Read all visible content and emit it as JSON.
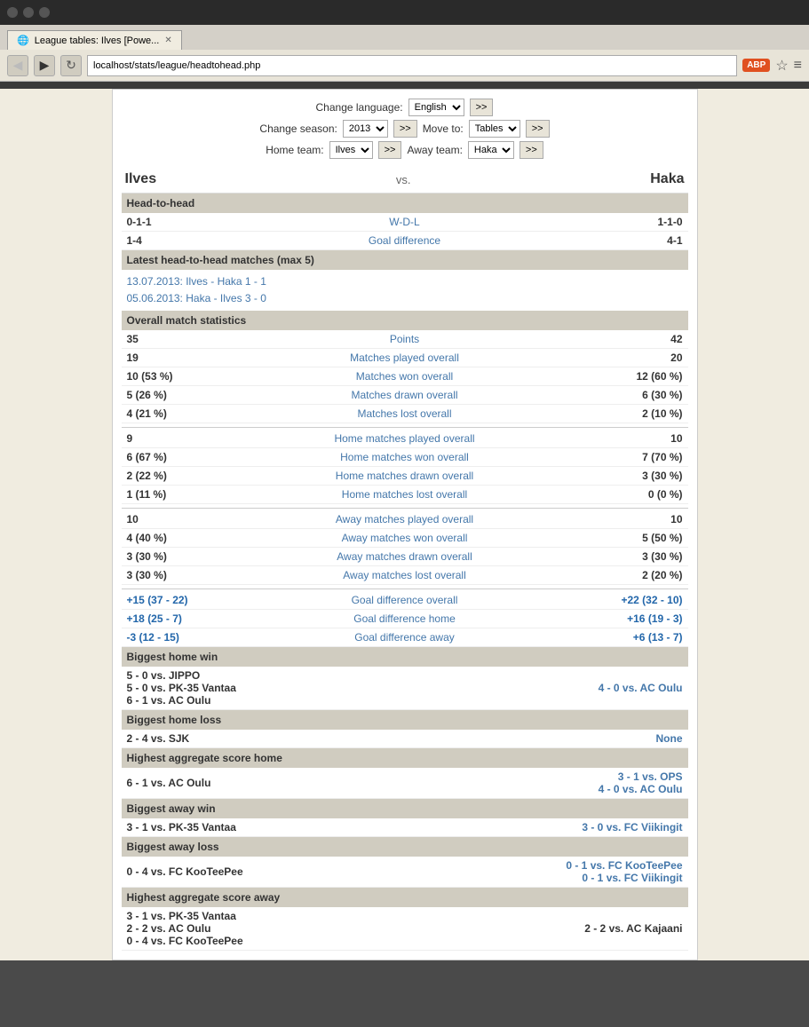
{
  "browser": {
    "title": "League tables: Ilves [Powe...",
    "url": "localhost/stats/league/headtohead.php"
  },
  "controls": {
    "change_language_label": "Change language:",
    "change_season_label": "Change season:",
    "move_to_label": "Move to:",
    "home_team_label": "Home team:",
    "away_team_label": "Away team:",
    "language_value": "English",
    "season_value": "2013",
    "move_to_value": "Tables",
    "home_team_value": "Ilves",
    "away_team_value": "Haka",
    "go_btn": ">>",
    "go_btn2": ">>",
    "go_btn3": ">>",
    "go_btn4": ">>"
  },
  "teams": {
    "home": "Ilves",
    "vs": "vs.",
    "away": "Haka"
  },
  "head_to_head": {
    "section_title": "Head-to-head",
    "wdl_label": "W-D-L",
    "home_wdl": "0-1-1",
    "away_wdl": "1-1-0",
    "goal_diff_label": "Goal difference",
    "home_goal_diff": "1-4",
    "away_goal_diff": "4-1"
  },
  "latest_matches": {
    "section_title": "Latest head-to-head matches (max 5)",
    "matches": [
      "13.07.2013: Ilves - Haka  1 - 1",
      "05.06.2013: Haka - Ilves  3 - 0"
    ]
  },
  "overall_stats": {
    "section_title": "Overall match statistics",
    "rows": [
      {
        "left": "35",
        "center": "Points",
        "right": "42"
      },
      {
        "left": "19",
        "center": "Matches played overall",
        "right": "20"
      },
      {
        "left": "10 (53 %)",
        "center": "Matches won overall",
        "right": "12 (60 %)"
      },
      {
        "left": "5 (26 %)",
        "center": "Matches drawn overall",
        "right": "6 (30 %)"
      },
      {
        "left": "4 (21 %)",
        "center": "Matches lost overall",
        "right": "2 (10 %)"
      }
    ],
    "home_rows": [
      {
        "left": "9",
        "center": "Home matches played overall",
        "right": "10"
      },
      {
        "left": "6 (67 %)",
        "center": "Home matches won overall",
        "right": "7 (70 %)"
      },
      {
        "left": "2 (22 %)",
        "center": "Home matches drawn overall",
        "right": "3 (30 %)"
      },
      {
        "left": "1 (11 %)",
        "center": "Home matches lost overall",
        "right": "0 (0 %)"
      }
    ],
    "away_rows": [
      {
        "left": "10",
        "center": "Away matches played overall",
        "right": "10"
      },
      {
        "left": "4 (40 %)",
        "center": "Away matches won overall",
        "right": "5 (50 %)"
      },
      {
        "left": "3 (30 %)",
        "center": "Away matches drawn overall",
        "right": "3 (30 %)"
      },
      {
        "left": "3 (30 %)",
        "center": "Away matches lost overall",
        "right": "2 (20 %)"
      }
    ],
    "goal_rows": [
      {
        "left": "+15 (37 - 22)",
        "center": "Goal difference overall",
        "right": "+22 (32 - 10)"
      },
      {
        "left": "+18 (25 - 7)",
        "center": "Goal difference home",
        "right": "+16 (19 - 3)"
      },
      {
        "left": "-3 (12 - 15)",
        "center": "Goal difference away",
        "right": "+6 (13 - 7)"
      }
    ]
  },
  "biggest_home_win": {
    "section_title": "Biggest home win",
    "home_results": [
      "5 - 0 vs. JIPPO",
      "5 - 0 vs. PK-35 Vantaa",
      "6 - 1 vs. AC Oulu"
    ],
    "away_result": "4 - 0 vs. AC Oulu"
  },
  "biggest_home_loss": {
    "section_title": "Biggest home loss",
    "home_result": "2 - 4 vs. SJK",
    "away_result": "None"
  },
  "highest_aggregate_home": {
    "section_title": "Highest aggregate score home",
    "home_result": "6 - 1 vs. AC Oulu",
    "away_results": [
      "3 - 1 vs. OPS",
      "4 - 0 vs. AC Oulu"
    ]
  },
  "biggest_away_win": {
    "section_title": "Biggest away win",
    "home_result": "3 - 1 vs. PK-35 Vantaa",
    "away_result": "3 - 0 vs. FC Viikingit"
  },
  "biggest_away_loss": {
    "section_title": "Biggest away loss",
    "home_result": "0 - 4 vs. FC KooTeePee",
    "away_results": [
      "0 - 1 vs. FC KooTeePee",
      "0 - 1 vs. FC Viikingit"
    ]
  },
  "highest_aggregate_away": {
    "section_title": "Highest aggregate score away",
    "home_results": [
      "3 - 1 vs. PK-35 Vantaa",
      "2 - 2 vs. AC Oulu",
      "0 - 4 vs. FC KooTeePee"
    ],
    "away_result": "2 - 2 vs. AC Kajaani"
  }
}
